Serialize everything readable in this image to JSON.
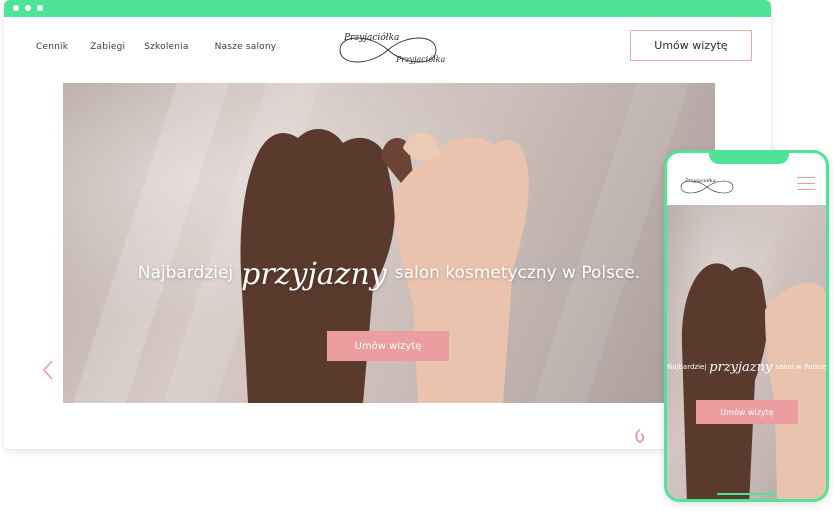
{
  "nav": {
    "items": [
      {
        "label": "Cennik"
      },
      {
        "label": "Zabiegi"
      },
      {
        "label": "Szkolenia"
      },
      {
        "label": "Nasze salony"
      }
    ]
  },
  "header": {
    "logo_text_1": "Przyjaciółka",
    "logo_text_2": "Przyjaciółka",
    "cta_label": "Umów wizytę"
  },
  "hero": {
    "headline_before": "Najbardziej",
    "headline_script": "przyjazny",
    "headline_after": "salon kosmetyczny w Polsce.",
    "button_label": "Umów wizytę"
  },
  "mobile": {
    "logo_text": "Przyjaciółka",
    "headline_before": "Najbardziej",
    "headline_script": "przyjazny",
    "headline_after": "salon w Polsce.",
    "button_label": "Umów wizytę"
  },
  "colors": {
    "accent_green": "#4fe39a",
    "accent_pink": "#ec9d9f"
  },
  "icons": {
    "prev": "chevron-left-icon",
    "menu": "hamburger-icon",
    "chat": "swirl-icon"
  }
}
